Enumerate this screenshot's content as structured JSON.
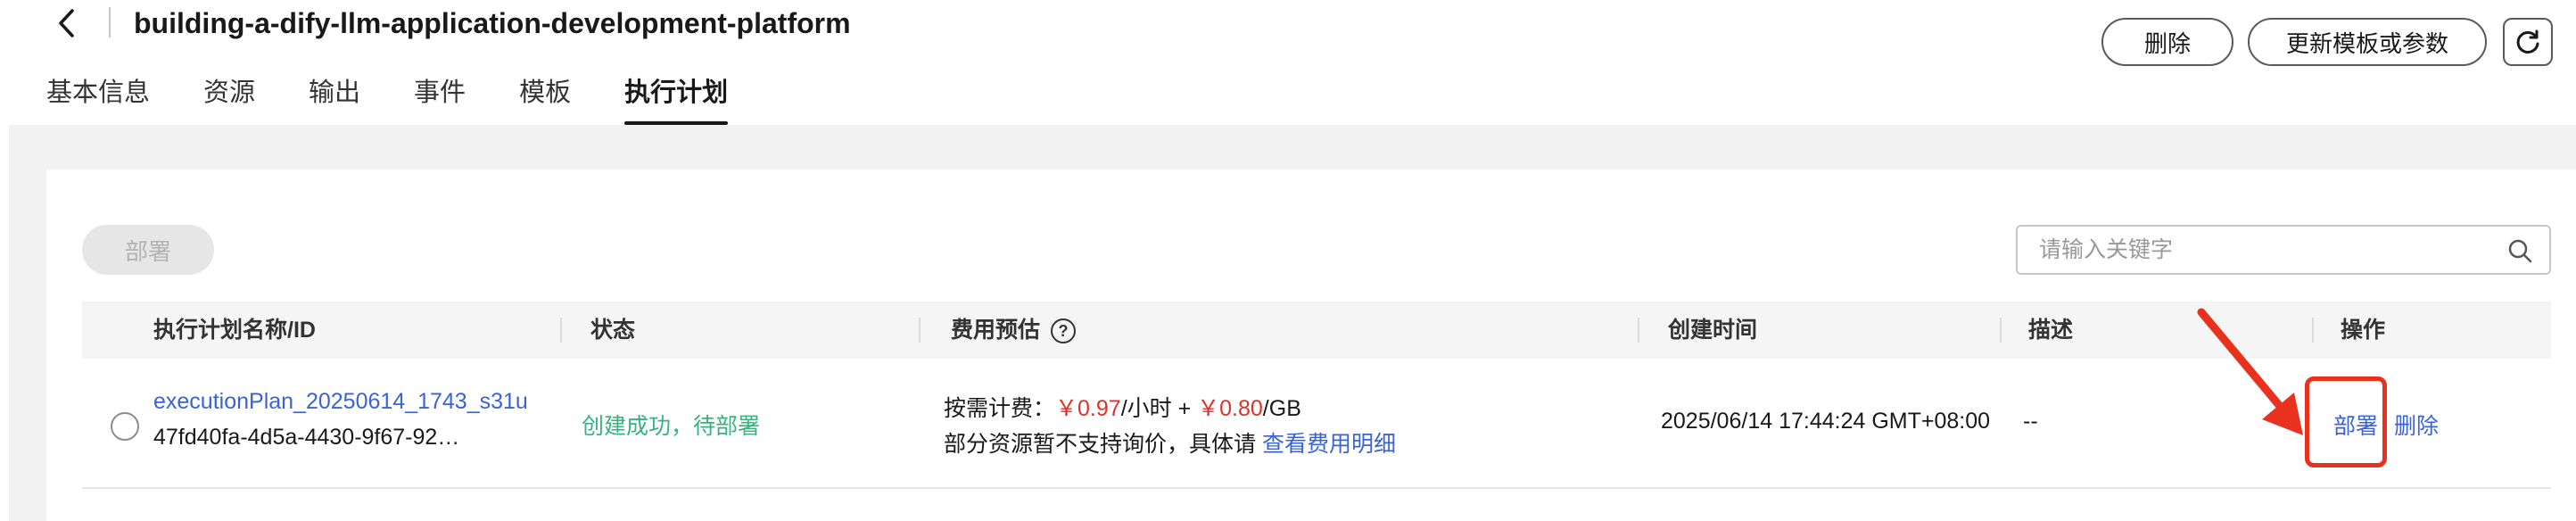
{
  "header": {
    "title": "building-a-dify-llm-application-development-platform",
    "tabs": [
      "基本信息",
      "资源",
      "输出",
      "事件",
      "模板",
      "执行计划"
    ],
    "active_tab": "执行计划",
    "delete_label": "删除",
    "update_label": "更新模板或参数"
  },
  "toolbar": {
    "deploy_label": "部署",
    "search_placeholder": "请输入关键字"
  },
  "table": {
    "columns": [
      "执行计划名称/ID",
      "状态",
      "费用预估",
      "创建时间",
      "描述",
      "操作"
    ],
    "rows": [
      {
        "name": "executionPlan_20250614_1743_s31u",
        "id": "47fd40fa-4d5a-4430-9f67-92…",
        "status": "创建成功，待部署",
        "cost_prefix": "按需计费：",
        "cost_hour": "￥0.97",
        "cost_hour_unit": "/小时 + ",
        "cost_gb": "￥0.80",
        "cost_gb_unit": "/GB",
        "cost_note": "部分资源暂不支持询价，具体请 ",
        "cost_link": "查看费用明细",
        "created": "2025/06/14 17:44:24 GMT+08:00",
        "description": "--",
        "action_deploy": "部署",
        "action_delete": "删除"
      }
    ]
  },
  "colors": {
    "link": "#3a63d8",
    "success": "#36b37e",
    "price": "#e0302a",
    "annotation": "#e8321e"
  },
  "icons": [
    "back-chevron-icon",
    "refresh-icon",
    "search-icon",
    "help-circle-icon",
    "annotation-arrow"
  ]
}
